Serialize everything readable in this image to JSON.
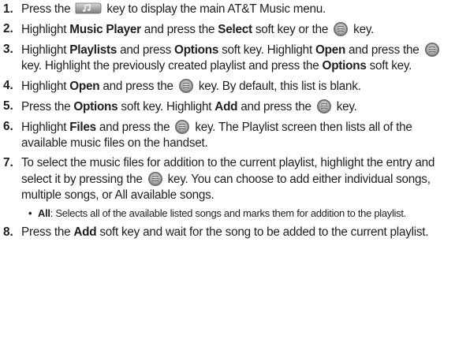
{
  "steps": [
    {
      "num": "1.",
      "parts": [
        "Press the ",
        "{music-key}",
        " key to display the main AT&T Music menu."
      ]
    },
    {
      "num": "2.",
      "parts": [
        "Highlight ",
        "**Music Player",
        " and press the ",
        "**Select",
        " soft key or the ",
        "{round-key}",
        " key."
      ]
    },
    {
      "num": "3.",
      "parts": [
        "Highlight ",
        "**Playlists",
        " and press ",
        "**Options",
        " soft key. Highlight ",
        "**Open",
        " and press the ",
        "{round-key}",
        " key. Highlight the previously created playlist and press the ",
        "**Options",
        " soft key."
      ]
    },
    {
      "num": "4.",
      "parts": [
        "Highlight ",
        "**Open",
        " and press the ",
        "{round-key}",
        " key. By default, this list is blank."
      ]
    },
    {
      "num": "5.",
      "parts": [
        "Press the ",
        "**Options",
        " soft key. Highlight ",
        "**Add",
        " and press the ",
        "{round-key}",
        " key."
      ]
    },
    {
      "num": "6.",
      "parts": [
        "Highlight ",
        "**Files",
        " and press the ",
        "{round-key}",
        " key. The Playlist screen then lists all of the available music files on the handset."
      ]
    },
    {
      "num": "7.",
      "parts": [
        "To select the music files for addition to the current playlist, highlight the entry and select it by pressing the ",
        "{round-key}",
        " key. You can choose to add either individual songs, multiple songs, or All available songs."
      ],
      "sub": {
        "bullet": "•",
        "parts": [
          "**All",
          ": Selects all of the available listed songs and marks them for addition to the playlist."
        ]
      }
    },
    {
      "num": "8.",
      "parts": [
        "Press the ",
        "**Add",
        " soft key and wait for the song to be added to the current playlist."
      ]
    }
  ],
  "icons": {
    "music-key": "music-note-key-icon",
    "round-key": "select-key-icon"
  }
}
